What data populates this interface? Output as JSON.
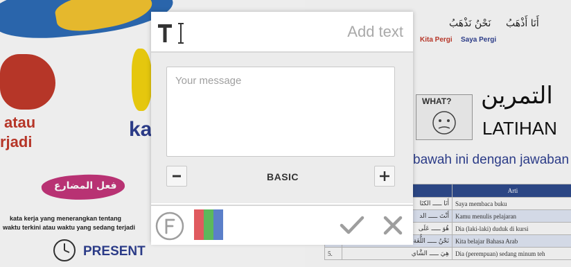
{
  "background": {
    "left_text_1": "atau",
    "left_text_2": "rjadi",
    "left_text_3": "ka",
    "left_badge": "فعل المضارع",
    "left_desc_1": "kata kerja yang menerangkan tentang",
    "left_desc_2": "waktu terkini atau waktu yang sedang terjadi",
    "present_label": "PRESENT",
    "top_arabic_1": "أَنَا أَذْهَبُ",
    "top_arabic_2": "نَحْنُ نَذْهَبُ",
    "top_caption_1": "Saya Pergi",
    "top_caption_2": "Kita Pergi",
    "meme_caption": "WHAT?",
    "exercise_arabic": "التمرين",
    "exercise_title": "LATIHAN",
    "instruction": "bawah ini dengan jawaban",
    "table_header": "Arti",
    "table_rows": [
      {
        "num": "",
        "arabic": "أَنَا ـــــ الكتَا",
        "meaning": "Saya membaca buku"
      },
      {
        "num": "",
        "arabic": "أَنْتَ ـــــ الد",
        "meaning": "Kamu menulis pelajaran"
      },
      {
        "num": "",
        "arabic": "هُوَ ـــــ عَلَى",
        "meaning": "Dia (laki-laki) duduk di kursi"
      },
      {
        "num": "4.",
        "arabic": "نَحْنُ ـــــ اللُّغَة العَرَبِيَّة",
        "meaning": "Kita belajar Bahasa Arab"
      },
      {
        "num": "5.",
        "arabic": "هِيَ ـــــ الشَّاي",
        "meaning": "Dia (perempuan) sedang minum teh"
      }
    ]
  },
  "dialog": {
    "title": "Add text",
    "message_placeholder": "Your message",
    "message_value": "",
    "size_label": "BASIC",
    "colors": [
      "#e05a5f",
      "#5cb85c",
      "#5b7fc9"
    ],
    "accent": "#9e9e9e"
  }
}
